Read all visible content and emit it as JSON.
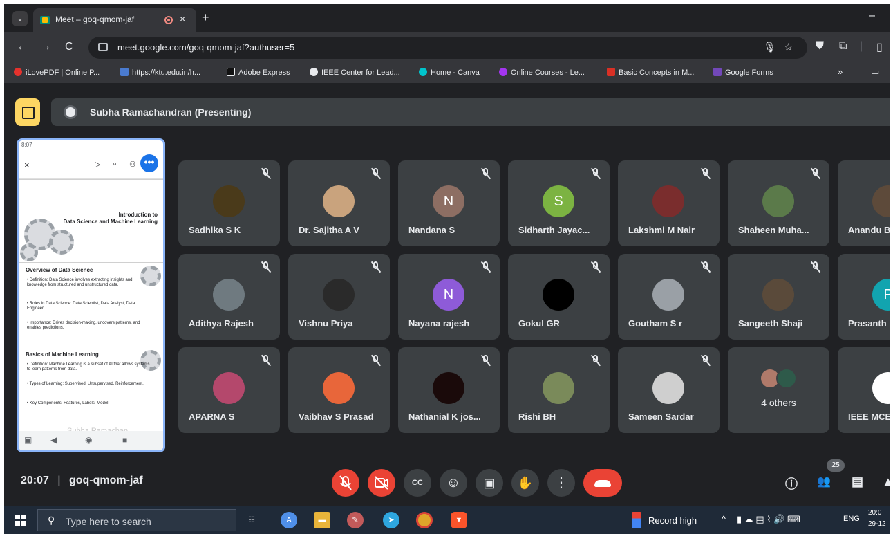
{
  "browser": {
    "tab_title": "Meet – goq-qmom-jaf",
    "tab_close": "×",
    "new_tab": "+",
    "minimize": "–",
    "url": "meet.google.com/goq-qmom-jaf?authuser=5",
    "nav": {
      "back": "←",
      "forward": "→",
      "reload": "C"
    },
    "omnibox_icons": {
      "mic": "🎙",
      "star": "☆"
    },
    "bookmarks": [
      {
        "label": "iLovePDF | Online P...",
        "color": "#e5322d"
      },
      {
        "label": "https://ktu.edu.in/h...",
        "color": "#4a7bd0"
      },
      {
        "label": "Adobe Express",
        "color": "#111111"
      },
      {
        "label": "IEEE Center for Lead...",
        "color": "#e8eaed"
      },
      {
        "label": "Home - Canva",
        "color": "#00c4cc"
      },
      {
        "label": "Online Courses - Le...",
        "color": "#a435f0"
      },
      {
        "label": "Basic Concepts in M...",
        "color": "#d93025"
      },
      {
        "label": "Google Forms",
        "color": "#7248b9"
      }
    ],
    "bookmarks_more": "»"
  },
  "meet": {
    "presenter_label": "Subha Ramachandran (Presenting)",
    "shared_screen": {
      "status_time": "8:07",
      "close": "×",
      "more": "•••",
      "slide1_title_line1": "Introduction to",
      "slide1_title_line2": "Data Science and Machine Learning",
      "slide2_heading": "Overview of Data Science",
      "slide2_bullets": [
        "• Definition: Data Science involves extracting insights and knowledge from structured and unstructured data.",
        "• Roles in Data Science: Data Scientist, Data Analyst, Data Engineer.",
        "• Importance: Drives decision-making, uncovers patterns, and enables predictions."
      ],
      "slide3_heading": "Basics of Machine Learning",
      "slide3_bullets": [
        "• Definition: Machine Learning is a subset of AI that allows systems to learn patterns from data.",
        "• Types of Learning: Supervised, Unsupervised, Reinforcement.",
        "• Key Components: Features, Labels, Model."
      ],
      "watermark": "Subha Ramachan..."
    },
    "participants": [
      {
        "name": "Sadhika S K",
        "avatar": "",
        "bg": "#4a3a1a"
      },
      {
        "name": "Dr. Sajitha A V",
        "avatar": "",
        "bg": "#c9a37d"
      },
      {
        "name": "Nandana S",
        "avatar": "N",
        "bg": "#8d6e63"
      },
      {
        "name": "Sidharth Jayac...",
        "avatar": "S",
        "bg": "#7cb342"
      },
      {
        "name": "Lakshmi M Nair",
        "avatar": "",
        "bg": "#7a2d2d"
      },
      {
        "name": "Shaheen Muha...",
        "avatar": "",
        "bg": "#5b7a4a"
      },
      {
        "name": "Anandu B",
        "avatar": "",
        "bg": "#5d4a3a"
      },
      {
        "name": "Adithya Rajesh",
        "avatar": "",
        "bg": "#6f7a80"
      },
      {
        "name": "Vishnu Priya",
        "avatar": "",
        "bg": "#2a2a2a"
      },
      {
        "name": "Nayana rajesh",
        "avatar": "N",
        "bg": "#8e5bd8"
      },
      {
        "name": "Gokul GR",
        "avatar": "",
        "bg": "#000000"
      },
      {
        "name": "Goutham S r",
        "avatar": "",
        "bg": "#9aa0a6"
      },
      {
        "name": "Sangeeth Shaji",
        "avatar": "",
        "bg": "#5a4a3a"
      },
      {
        "name": "Prasanth",
        "avatar": "P",
        "bg": "#12a4af"
      },
      {
        "name": "APARNA S",
        "avatar": "",
        "bg": "#b4486c"
      },
      {
        "name": "Vaibhav S Prasad",
        "avatar": "",
        "bg": "#e8663a"
      },
      {
        "name": "Nathanial K jos...",
        "avatar": "",
        "bg": "#1a0a0a"
      },
      {
        "name": "Rishi BH",
        "avatar": "",
        "bg": "#7a8a5a"
      },
      {
        "name": "Sameen Sardar",
        "avatar": "",
        "bg": "#cfcfcf"
      },
      {
        "name": "IEEE MCE",
        "avatar": "",
        "bg": "#ffffff"
      }
    ],
    "others_label": "4 others",
    "meeting_time": "20:07",
    "meeting_code": "goq-qmom-jaf",
    "separator": "|",
    "participant_count": "25",
    "controls": {
      "captions": "CC",
      "emoji": "☺",
      "present": "▣",
      "hand": "✋",
      "more": "⋮",
      "info": "ⓘ",
      "people": "👥",
      "chat": "▤"
    }
  },
  "taskbar": {
    "search_placeholder": "Type here to search",
    "record_high": "Record high",
    "language": "ENG",
    "clock_time": "20:0",
    "clock_date": "29-12"
  },
  "colors": {
    "accent_red": "#ea4335",
    "meet_bg": "#202124",
    "tile_bg": "#3c4043",
    "present_yellow": "#fdd663"
  }
}
